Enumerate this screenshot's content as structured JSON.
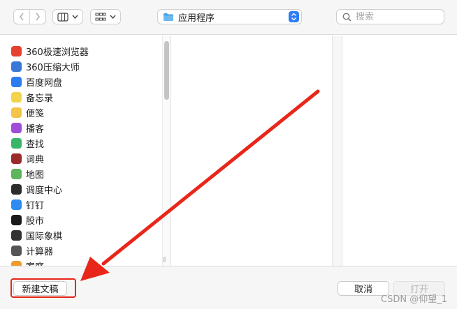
{
  "toolbar": {
    "back_icon": "chevron-left-icon",
    "forward_icon": "chevron-right-icon",
    "view_icon": "column-view-icon",
    "group_icon": "grid-view-icon",
    "location": {
      "label": "应用程序",
      "icon": "folder-icon"
    },
    "search": {
      "placeholder": "搜索",
      "value": ""
    }
  },
  "sidebar": {
    "items": [
      {
        "label": "360极速浏览器",
        "icon": "360-browser-icon",
        "color": "#e6402f"
      },
      {
        "label": "360压缩大师",
        "icon": "360-zip-icon",
        "color": "#3a78d8"
      },
      {
        "label": "百度网盘",
        "icon": "baidu-netdisk-icon",
        "color": "#2b7cf0"
      },
      {
        "label": "备忘录",
        "icon": "notes-icon",
        "color": "#f2d34a"
      },
      {
        "label": "便笺",
        "icon": "stickies-icon",
        "color": "#f4c44a"
      },
      {
        "label": "播客",
        "icon": "podcasts-icon",
        "color": "#a24cd9"
      },
      {
        "label": "查找",
        "icon": "find-my-icon",
        "color": "#39b56a"
      },
      {
        "label": "词典",
        "icon": "dictionary-icon",
        "color": "#9b2a2a"
      },
      {
        "label": "地图",
        "icon": "maps-icon",
        "color": "#5fb55b"
      },
      {
        "label": "调度中心",
        "icon": "mission-control-icon",
        "color": "#2c2c2c"
      },
      {
        "label": "钉钉",
        "icon": "dingtalk-icon",
        "color": "#2e8cf0"
      },
      {
        "label": "股市",
        "icon": "stocks-icon",
        "color": "#1a1a1a"
      },
      {
        "label": "国际象棋",
        "icon": "chess-icon",
        "color": "#333333"
      },
      {
        "label": "计算器",
        "icon": "calculator-icon",
        "color": "#555555"
      },
      {
        "label": "家庭",
        "icon": "home-icon",
        "color": "#f19a2c"
      }
    ]
  },
  "footer": {
    "new_document": "新建文稿",
    "cancel": "取消",
    "open": "打开",
    "watermark": "CSDN @仰望_1"
  },
  "colors": {
    "highlight": "#e8261a",
    "accent": "#2f7cf6"
  }
}
